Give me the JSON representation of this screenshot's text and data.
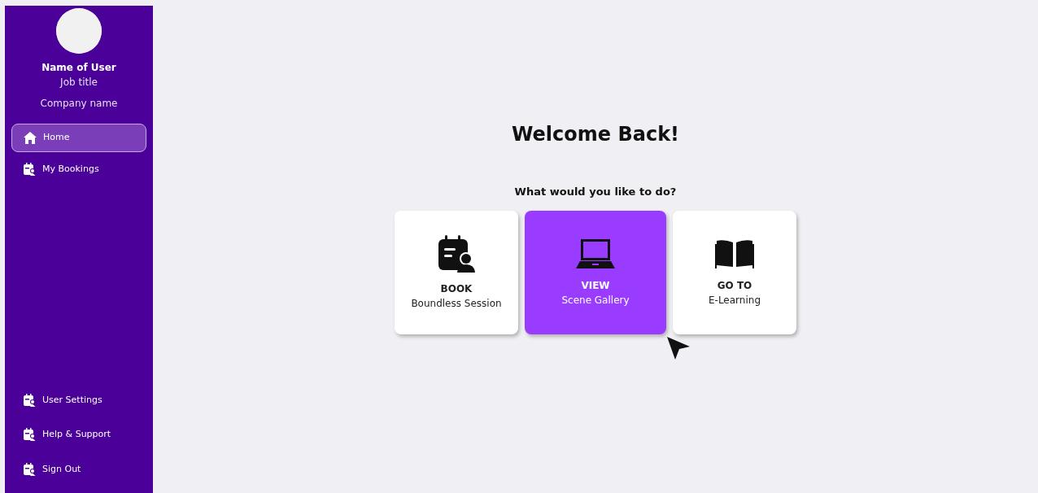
{
  "user": {
    "name": "Name of User",
    "job_title": "Job title",
    "company": "Company name"
  },
  "nav": [
    {
      "label": "Home",
      "kind": "home",
      "selected": true
    },
    {
      "label": "My Bookings",
      "kind": "booking",
      "selected": false
    }
  ],
  "nav_bottom": [
    {
      "label": "User Settings",
      "kind": "booking"
    },
    {
      "label": "Help & Support",
      "kind": "booking"
    },
    {
      "label": "Sign Out",
      "kind": "booking"
    }
  ],
  "heading": "Welcome Back!",
  "prompt": "What would you like to do?",
  "actions": [
    {
      "verb": "BOOK",
      "label": "Boundless Session",
      "kind": "calendar",
      "selected": false
    },
    {
      "verb": "VIEW",
      "label": "Scene Gallery",
      "kind": "laptop",
      "selected": true
    },
    {
      "verb": "GO TO",
      "label": "E-Learning",
      "kind": "book",
      "selected": false
    }
  ]
}
